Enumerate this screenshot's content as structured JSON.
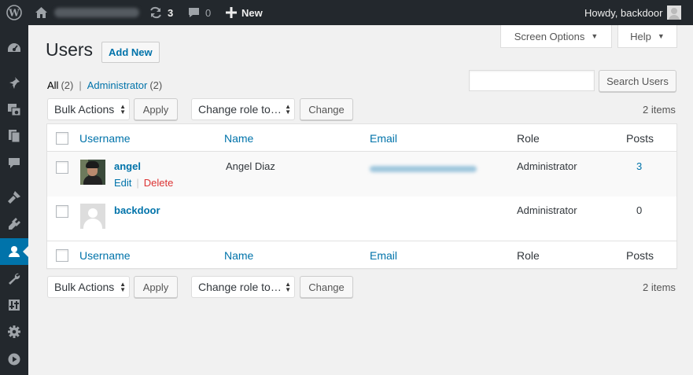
{
  "adminbar": {
    "update_count": "3",
    "comment_count": "0",
    "new_label": "New",
    "howdy_text": "Howdy, backdoor"
  },
  "sidebar": {
    "items": [
      {
        "icon": "dashboard-icon"
      },
      {
        "icon": "pin-icon"
      },
      {
        "icon": "media-icon"
      },
      {
        "icon": "pages-icon"
      },
      {
        "icon": "comments-icon"
      },
      {
        "icon": "appearance-icon"
      },
      {
        "icon": "plugins-icon"
      },
      {
        "icon": "users-icon",
        "current": true
      },
      {
        "icon": "tools-icon"
      },
      {
        "icon": "settings-icon"
      },
      {
        "icon": "gear-icon"
      },
      {
        "icon": "play-icon"
      }
    ]
  },
  "header": {
    "screen_options": "Screen Options",
    "help": "Help",
    "title": "Users",
    "add_new": "Add New"
  },
  "filters": {
    "all_label": "All",
    "all_count": "(2)",
    "separator": "|",
    "admin_label": "Administrator",
    "admin_count": "(2)"
  },
  "search": {
    "placeholder": "",
    "button": "Search Users"
  },
  "tablenav": {
    "bulk_actions": "Bulk Actions",
    "apply": "Apply",
    "change_role": "Change role to…",
    "change": "Change",
    "items_count": "2 items"
  },
  "table": {
    "columns": {
      "username": "Username",
      "name": "Name",
      "email": "Email",
      "role": "Role",
      "posts": "Posts"
    },
    "rows": [
      {
        "username": "angel",
        "name": "Angel Diaz",
        "role": "Administrator",
        "posts": "3",
        "actions": {
          "edit": "Edit",
          "separator": "|",
          "delete": "Delete"
        }
      },
      {
        "username": "backdoor",
        "name": "",
        "role": "Administrator",
        "posts": "0"
      }
    ]
  },
  "colors": {
    "adminbar_bg": "#23282d",
    "link": "#0073aa",
    "current_menu": "#0073aa",
    "delete": "#dc3232",
    "page_bg": "#f1f1f1"
  }
}
